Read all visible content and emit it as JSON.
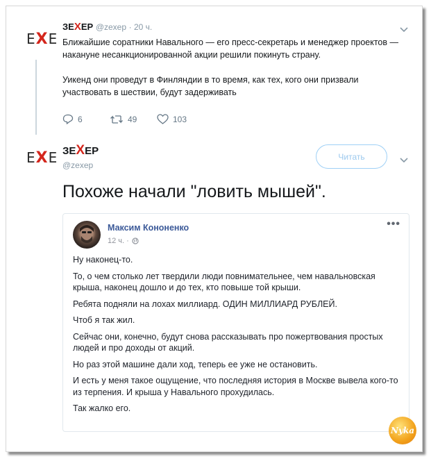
{
  "tweet1": {
    "logo_left": "E",
    "logo_mid": "X",
    "logo_right": "E",
    "name_pre": "ЗЕ",
    "name_x": "Х",
    "name_post": "ЕР",
    "handle": "@zexep",
    "time": "· 20 ч.",
    "text_p1": "Ближайшие соратники Навального — его пресс-секретарь и менеджер проектов — накануне несанкционированной акции решили покинуть страну.",
    "text_p2": "Уикенд они проведут в Финляндии в то время, как тех, кого они призвали участвовать в шествии, будут задерживать",
    "replies": "6",
    "retweets": "49",
    "likes": "103"
  },
  "tweet2": {
    "name_pre": "ЗЕ",
    "name_x": "Х",
    "name_post": "ЕР",
    "handle": "@zexep",
    "follow_label": "Читать",
    "text": "Похоже начали \"ловить мышей\"."
  },
  "fb_post": {
    "author": "Максим Кононенко",
    "time": "12 ч. ·",
    "paragraphs": [
      "Ну наконец-то.",
      "То, о чем столько лет твердили люди повнимательнее, чем навальновская крыша, наконец дошло и до тех, кто повыше той крыши.",
      "Ребята подняли на лохах миллиард. ОДИН МИЛЛИАРД РУБЛЕЙ.",
      "Чтоб я так жил.",
      "Сейчас они, конечно, будут снова рассказывать про пожертвования простых людей и про доходы от акций.",
      "Но раз этой машине дали ход, теперь ее уже не остановить.",
      "И есть у меня такое ощущение, что последняя история в Москве вывела кого-то из терпения. И крыша у Навального прохудилась.",
      "Так жалко его."
    ]
  },
  "watermark": "Nyka",
  "icons": {
    "reply": "reply-icon",
    "retweet": "retweet-icon",
    "like": "heart-icon",
    "chevron": "chevron-down-icon",
    "globe": "globe-icon",
    "more": "more-icon"
  }
}
